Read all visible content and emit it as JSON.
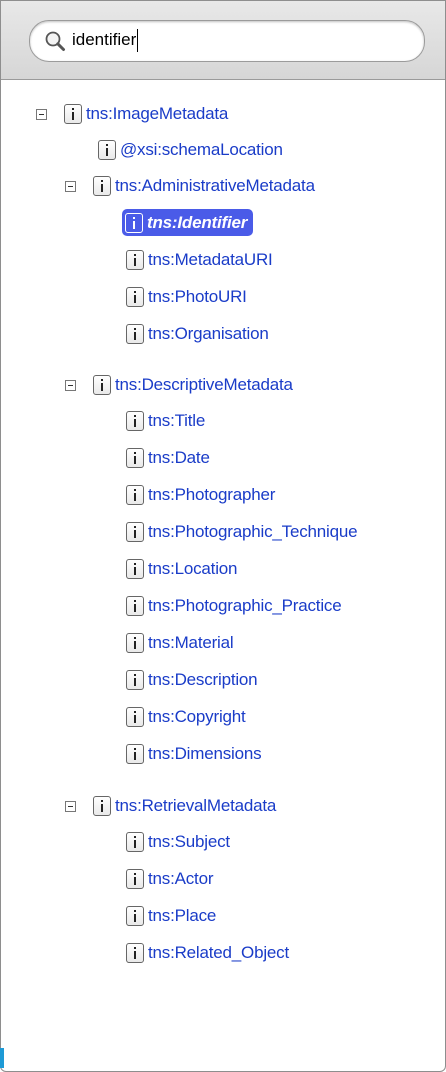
{
  "search": {
    "value": "identifier",
    "icon": "magnifier-icon"
  },
  "tree": {
    "image_metadata": {
      "label": "tns:ImageMetadata",
      "schema_location": "@xsi:schemaLocation"
    },
    "administrative": {
      "label": "tns:AdministrativeMetadata",
      "children": [
        "tns:Identifier",
        "tns:MetadataURI",
        "tns:PhotoURI",
        "tns:Organisation"
      ]
    },
    "descriptive": {
      "label": "tns:DescriptiveMetadata",
      "children": [
        "tns:Title",
        "tns:Date",
        "tns:Photographer",
        "tns:Photographic_Technique",
        "tns:Location",
        "tns:Photographic_Practice",
        "tns:Material",
        "tns:Description",
        "tns:Copyright",
        "tns:Dimensions"
      ]
    },
    "retrieval": {
      "label": "tns:RetrievalMetadata",
      "children": [
        "tns:Subject",
        "tns:Actor",
        "tns:Place",
        "tns:Related_Object"
      ]
    },
    "selected": "tns:Identifier"
  },
  "colors": {
    "link": "#1a3cc8",
    "selection": "#4a5be8"
  }
}
